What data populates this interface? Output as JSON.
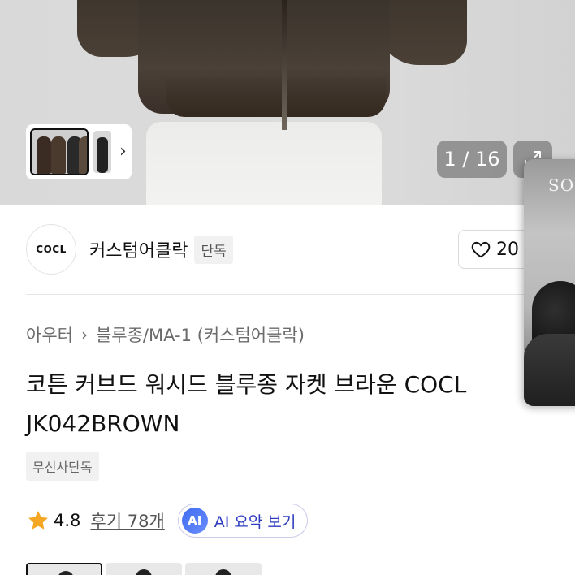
{
  "gallery": {
    "counter": "1 / 16",
    "expand_icon": "expand-icon",
    "thumb_chevron": "›"
  },
  "popup": {
    "label": "SO"
  },
  "brand": {
    "logo_text": "COCL",
    "name": "커스텀어클락",
    "badge": "단독"
  },
  "like": {
    "count": "20"
  },
  "breadcrumb": {
    "items": [
      "아우터",
      "블루종/MA-1 (커스텀어클락)"
    ],
    "separator": "›"
  },
  "product": {
    "title_line1": "코튼 커브드 워시드 블루종 자켓 브라운 COCL",
    "title_line2": "JK042BROWN",
    "tag": "무신사단독"
  },
  "rating": {
    "value": "4.8",
    "reviews_link": "후기 78개",
    "star_color": "#f5a623"
  },
  "ai_summary": {
    "icon_text": "AI",
    "label": "AI 요약 보기"
  }
}
